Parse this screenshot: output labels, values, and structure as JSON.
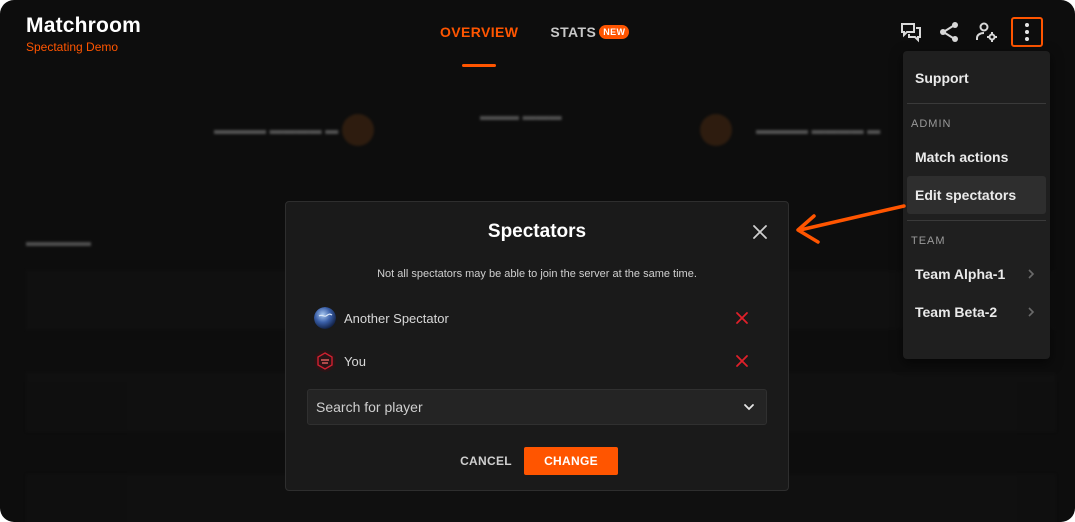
{
  "brand": {
    "title": "Matchroom",
    "subtitle": "Spectating Demo"
  },
  "tabs": [
    {
      "label": "OVERVIEW",
      "active": true
    },
    {
      "label": "STATS",
      "badge": "NEW",
      "active": false
    }
  ],
  "toolbar_icons": [
    "chat-icon",
    "share-icon",
    "admin-settings-icon",
    "more-vertical-icon"
  ],
  "menu": {
    "support": "Support",
    "admin_header": "ADMIN",
    "match_actions": "Match actions",
    "edit_spectators": "Edit spectators",
    "team_header": "TEAM",
    "team_a": "Team Alpha-1",
    "team_b": "Team Beta-2"
  },
  "modal": {
    "title": "Spectators",
    "note": "Not all spectators may be able to join the server at the same time.",
    "spectators": [
      {
        "name": "Another Spectator",
        "avatar": "globe-avatar"
      },
      {
        "name": "You",
        "avatar": "shield-avatar"
      }
    ],
    "search_placeholder": "Search for player",
    "cancel_label": "CANCEL",
    "change_label": "CHANGE"
  },
  "colors": {
    "accent": "#ff5500",
    "background": "#0d0d0d",
    "panel": "#1a1a1a",
    "remove": "#e0202a"
  }
}
